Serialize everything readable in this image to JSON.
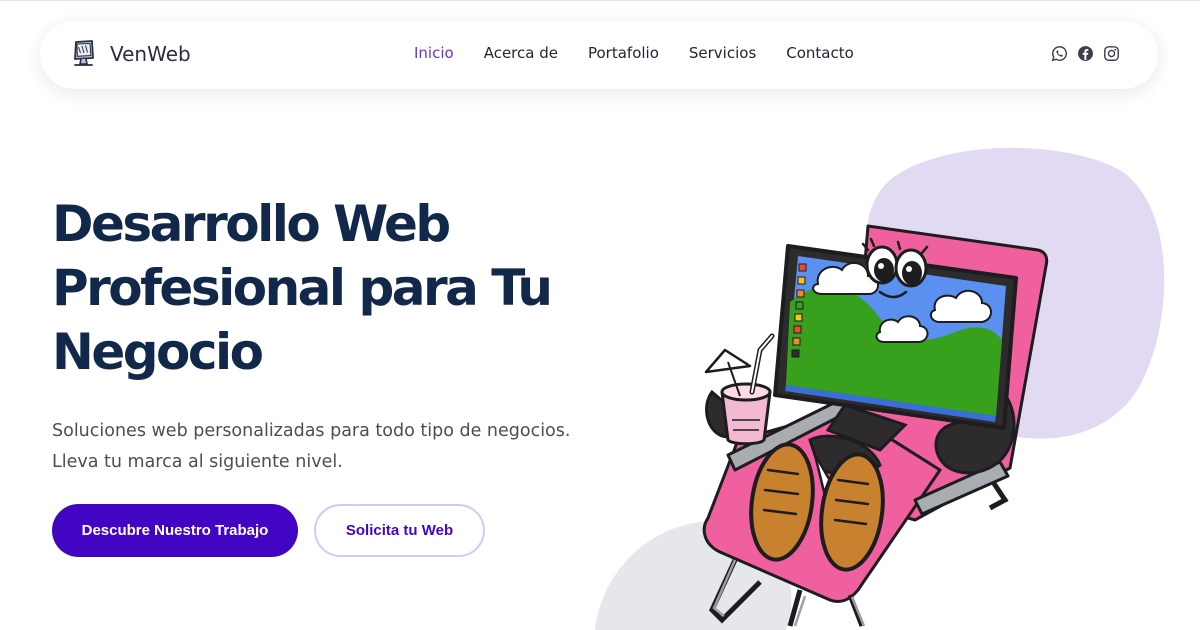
{
  "brand": {
    "name": "VenWeb",
    "logo_icon": "monitor-logo-icon"
  },
  "nav": {
    "items": [
      {
        "label": "Inicio",
        "active": true
      },
      {
        "label": "Acerca de",
        "active": false
      },
      {
        "label": "Portafolio",
        "active": false
      },
      {
        "label": "Servicios",
        "active": false
      },
      {
        "label": "Contacto",
        "active": false
      }
    ],
    "active_color": "#6a31d8"
  },
  "socials": [
    {
      "icon": "whatsapp-icon"
    },
    {
      "icon": "facebook-icon"
    },
    {
      "icon": "instagram-icon"
    }
  ],
  "hero": {
    "title": "Desarrollo Web Profesional para Tu Negocio",
    "subtitle_line1": "Soluciones web personalizadas para todo tipo de negocios.",
    "subtitle_line2": "Lleva tu marca al siguiente nivel.",
    "primary_button": "Descubre Nuestro Trabajo",
    "secondary_button": "Solicita tu Web"
  },
  "colors": {
    "title": "#12284a",
    "primary": "#4305c4",
    "blob_purple": "#e2d9f3",
    "blob_gray": "#e5e7ea",
    "chair_pink": "#f0609e"
  }
}
